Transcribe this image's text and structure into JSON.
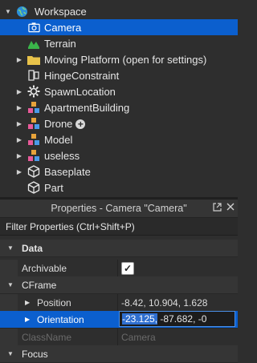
{
  "explorer": {
    "workspace": "Workspace",
    "items": [
      {
        "label": "Camera",
        "icon": "camera-icon",
        "expandable": false,
        "selected": true
      },
      {
        "label": "Terrain",
        "icon": "terrain-icon",
        "expandable": false
      },
      {
        "label": "Moving Platform (open for settings)",
        "icon": "folder-icon",
        "expandable": true
      },
      {
        "label": "HingeConstraint",
        "icon": "hinge-constraint-icon",
        "expandable": false
      },
      {
        "label": "SpawnLocation",
        "icon": "spawn-location-icon",
        "expandable": true
      },
      {
        "label": "ApartmentBuilding",
        "icon": "model-icon",
        "expandable": true
      },
      {
        "label": "Drone",
        "icon": "model-icon",
        "expandable": true,
        "badge": "+"
      },
      {
        "label": "Model",
        "icon": "model-icon",
        "expandable": true
      },
      {
        "label": "useless",
        "icon": "model-icon",
        "expandable": true
      },
      {
        "label": "Baseplate",
        "icon": "part-icon",
        "expandable": true
      },
      {
        "label": "Part",
        "icon": "part-icon",
        "expandable": false
      }
    ]
  },
  "properties": {
    "title": "Properties - Camera \"Camera\"",
    "filter_placeholder": "Filter Properties (Ctrl+Shift+P)",
    "categories": {
      "data": "Data",
      "cframe": "CFrame",
      "focus": "Focus"
    },
    "rows": {
      "archivable": "Archivable",
      "position": {
        "name": "Position",
        "value": "-8.42, 10.904, 1.628"
      },
      "orientation": {
        "name": "Orientation",
        "value_selected": "-23.125,",
        "value_rest": " -87.682, -0"
      },
      "classname": {
        "name": "ClassName",
        "value": "Camera"
      }
    }
  },
  "colors": {
    "selection": "#0b5fce",
    "background": "#2e2e2e",
    "model_orange": "#e8a33a",
    "terrain_green": "#3ab54a",
    "folder_yellow": "#e8c24a"
  }
}
